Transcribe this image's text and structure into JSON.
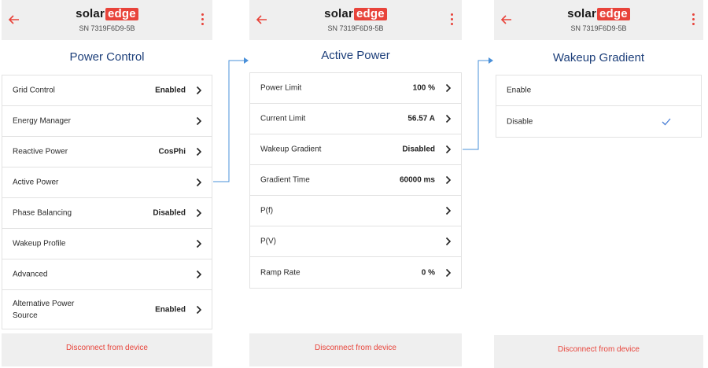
{
  "common": {
    "logo_solar": "solar",
    "logo_edge": "edge",
    "serial": "SN 7319F6D9-5B",
    "disconnect_label": "Disconnect from device",
    "accent_color": "#e8433a",
    "title_color": "#1d3f7a",
    "check_color": "#4a7fd6"
  },
  "screens": [
    {
      "title": "Power Control",
      "items": [
        {
          "label": "Grid Control",
          "value": "Enabled"
        },
        {
          "label": "Energy Manager",
          "value": ""
        },
        {
          "label": "Reactive Power",
          "value": "CosPhi"
        },
        {
          "label": "Active Power",
          "value": ""
        },
        {
          "label": "Phase Balancing",
          "value": "Disabled"
        },
        {
          "label": "Wakeup Profile",
          "value": ""
        },
        {
          "label": "Advanced",
          "value": ""
        },
        {
          "label_line1": "Alternative Power",
          "label_line2": "Source",
          "value": "Enabled"
        }
      ]
    },
    {
      "title": "Active Power",
      "items": [
        {
          "label": "Power Limit",
          "value": "100 %"
        },
        {
          "label": "Current Limit",
          "value": "56.57 A"
        },
        {
          "label": "Wakeup Gradient",
          "value": "Disabled"
        },
        {
          "label": "Gradient Time",
          "value": "60000 ms"
        },
        {
          "label": "P(f)",
          "value": ""
        },
        {
          "label": "P(V)",
          "value": ""
        },
        {
          "label": "Ramp Rate",
          "value": "0 %"
        }
      ]
    },
    {
      "title": "Wakeup Gradient",
      "options": [
        {
          "label": "Enable",
          "selected": false
        },
        {
          "label": "Disable",
          "selected": true
        }
      ]
    }
  ]
}
